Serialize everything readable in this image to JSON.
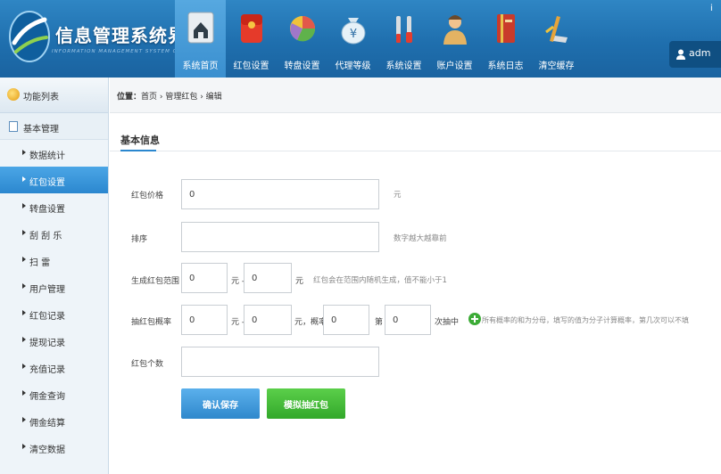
{
  "header": {
    "title": "信息管理系统界面",
    "subtitle": "INFORMATION MANAGEMENT SYSTEM GUI",
    "corner_text": "i"
  },
  "nav": [
    {
      "label": "系统首页",
      "icon": "home-icon",
      "active": true
    },
    {
      "label": "红包设置",
      "icon": "red-envelope-icon",
      "active": false
    },
    {
      "label": "转盘设置",
      "icon": "pie-wheel-icon",
      "active": false
    },
    {
      "label": "代理等级",
      "icon": "money-bag-icon",
      "active": false
    },
    {
      "label": "系统设置",
      "icon": "tools-icon",
      "active": false
    },
    {
      "label": "账户设置",
      "icon": "user-account-icon",
      "active": false
    },
    {
      "label": "系统日志",
      "icon": "log-book-icon",
      "active": false
    },
    {
      "label": "清空缓存",
      "icon": "clear-cache-icon",
      "active": false
    }
  ],
  "user": {
    "name": "adm"
  },
  "sidebar": {
    "header": "功能列表",
    "group": "基本管理",
    "items": [
      {
        "label": "数据统计",
        "active": false
      },
      {
        "label": "红包设置",
        "active": true
      },
      {
        "label": "转盘设置",
        "active": false
      },
      {
        "label": "刮 刮 乐",
        "active": false
      },
      {
        "label": "扫    雷",
        "active": false
      },
      {
        "label": "用户管理",
        "active": false
      },
      {
        "label": "红包记录",
        "active": false
      },
      {
        "label": "提现记录",
        "active": false
      },
      {
        "label": "充值记录",
        "active": false
      },
      {
        "label": "佣金查询",
        "active": false
      },
      {
        "label": "佣金结算",
        "active": false
      },
      {
        "label": "清空数据",
        "active": false
      }
    ]
  },
  "breadcrumb": {
    "prefix": "位置：",
    "path": "首页 › 管理红包 › 编辑"
  },
  "form": {
    "section_title": "基本信息",
    "price_label": "红包价格",
    "price_value": "0",
    "price_unit": "元",
    "sort_label": "排序",
    "sort_value": "",
    "sort_hint": "数字越大越靠前",
    "range_label": "生成红包范围",
    "range_min": "0",
    "range_sep": "元 -",
    "range_max": "0",
    "range_unit": "元",
    "range_hint": "红包会在范围内随机生成，值不能小于1",
    "prob_label": "抽红包概率",
    "prob_min": "0",
    "prob_sep": "元 -",
    "prob_max": "0",
    "prob_rate_label": "元，概率",
    "prob_rate": "0",
    "prob_nth_label": "第",
    "prob_nth": "0",
    "prob_nth_suffix": "次抽中",
    "prob_hint": "所有概率的和为分母，填写的值为分子计算概率，第几次可以不填",
    "count_label": "红包个数",
    "count_value": "",
    "save_button": "确认保存",
    "simulate_button": "模拟抽红包"
  },
  "colors": {
    "header_blue": "#1f6fae",
    "accent_blue": "#2b87cf",
    "save_button": "#3d95d6",
    "simulate_button": "#3fb435"
  }
}
